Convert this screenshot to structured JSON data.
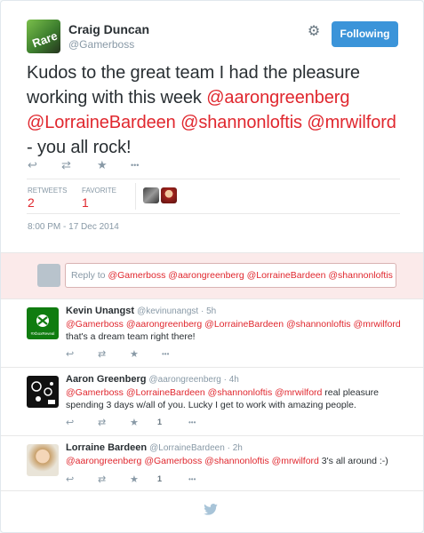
{
  "tweet": {
    "author_name": "Craig Duncan",
    "author_handle": "@Gamerboss",
    "avatar_text": "Rare",
    "follow_button": "Following",
    "text_parts": [
      {
        "t": "Kudos to the great team I had the pleasure working with this week ",
        "m": false
      },
      {
        "t": "@aarongreenberg",
        "m": true
      },
      {
        "t": " ",
        "m": false
      },
      {
        "t": "@LorraineBardeen",
        "m": true
      },
      {
        "t": " ",
        "m": false
      },
      {
        "t": "@shannonloftis",
        "m": true
      },
      {
        "t": " ",
        "m": false
      },
      {
        "t": "@mrwilford",
        "m": true
      },
      {
        "t": " - you all rock!",
        "m": false
      }
    ],
    "retweets_label": "RETWEETS",
    "retweets_count": "2",
    "favorites_label": "FAVORITE",
    "favorites_count": "1",
    "timestamp": "8:00 PM - 17 Dec 2014"
  },
  "reply_box": {
    "prefix": "Reply to ",
    "mentions": "@Gamerboss @aarongreenberg @LorraineBardeen @shannonloftis @m..."
  },
  "replies": [
    {
      "name": "Kevin Unangst",
      "handle": "@kevinunangst",
      "time": "5h",
      "text": "@Gamerboss @aarongreenberg @LorraineBardeen @shannonloftis @mrwilford that's a dream team right there!",
      "avatar_caption": "#XboxReveal",
      "favorites": ""
    },
    {
      "name": "Aaron Greenberg",
      "handle": "@aarongreenberg",
      "time": "4h",
      "text": "@Gamerboss @LorraineBardeen @shannonloftis @mrwilford real pleasure spending 3 days w/all of you. Lucky I get to work with amazing people.",
      "avatar_caption": "",
      "favorites": "1"
    },
    {
      "name": "Lorraine Bardeen",
      "handle": "@LorraineBardeen",
      "time": "2h",
      "text": "@aarongreenberg @Gamerboss @shannonloftis @mrwilford   3's all around :-)",
      "avatar_caption": "",
      "favorites": "1"
    }
  ],
  "icons": {
    "reply": "↩",
    "retweet": "⇄",
    "favorite": "★",
    "more": "•••",
    "gear": "⚙",
    "bird": "🐦"
  },
  "colors": {
    "mention": "#e0272e",
    "follow_button": "#3b94d9",
    "reply_bar": "#fbeaea"
  }
}
